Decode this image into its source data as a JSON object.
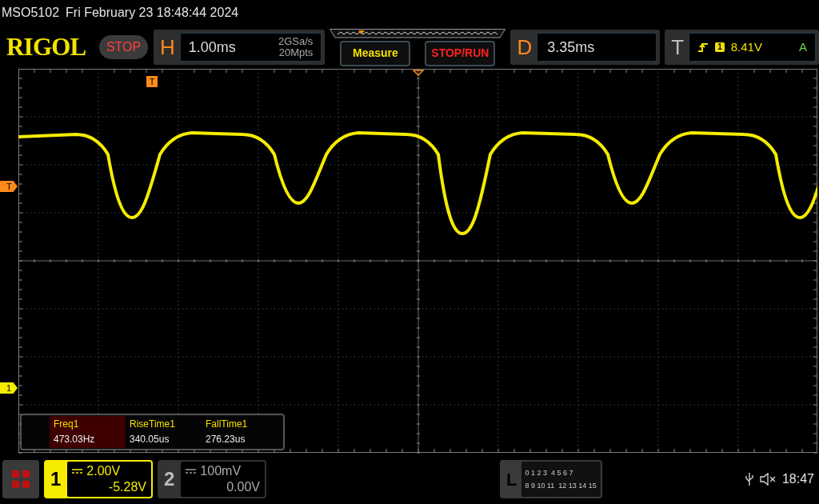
{
  "status_line": {
    "model": "MSO5102",
    "datetime": "Fri February 23 18:48:44 2024"
  },
  "toolbar": {
    "logo": "RIGOL",
    "run_state": "STOP",
    "horizontal": {
      "label": "H",
      "timebase": "1.00ms",
      "sample_rate": "2GSa/s",
      "memory_depth": "20Mpts"
    },
    "buttons": [
      "Measure",
      "STOP/RUN"
    ],
    "delay": {
      "label": "D",
      "value": "3.35ms"
    },
    "trigger": {
      "label": "T",
      "source": "1",
      "level": "8.41V",
      "mode": "A"
    }
  },
  "markers": {
    "trigger_time": "T",
    "trigger_level": "T",
    "channel": "1"
  },
  "measurements": [
    {
      "name": "Freq1",
      "value": "473.03Hz",
      "selected": true
    },
    {
      "name": "RiseTime1",
      "value": "340.05us",
      "selected": false
    },
    {
      "name": "FallTime1",
      "value": "276.23us",
      "selected": false
    }
  ],
  "channels": [
    {
      "number": "1",
      "scale": "2.00V",
      "offset": "-5.28V",
      "on": true
    },
    {
      "number": "2",
      "scale": "100mV",
      "offset": "0.00V",
      "on": false
    }
  ],
  "logic": {
    "label": "L",
    "rows": [
      [
        "0 1 2 3",
        "4 5 6 7"
      ],
      [
        "8 9 10 11",
        "12 13 14 15"
      ]
    ]
  },
  "clock": "18:47"
}
